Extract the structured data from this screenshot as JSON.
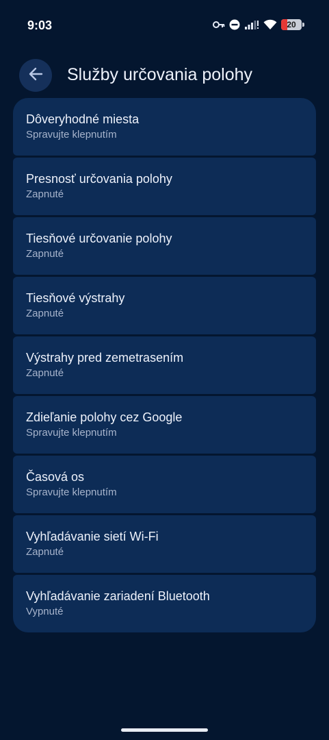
{
  "status": {
    "time": "9:03",
    "battery": "20",
    "icons": [
      "key-icon",
      "do-not-disturb-icon",
      "signal-icon",
      "wifi-icon",
      "battery-icon"
    ]
  },
  "header": {
    "title": "Služby určovania polohy",
    "back_icon": "arrow-left-icon"
  },
  "items": [
    {
      "title": "Dôveryhodné miesta",
      "subtitle": "Spravujte klepnutím"
    },
    {
      "title": "Presnosť určovania polohy",
      "subtitle": "Zapnuté"
    },
    {
      "title": "Tiesňové určovanie polohy",
      "subtitle": "Zapnuté"
    },
    {
      "title": "Tiesňové výstrahy",
      "subtitle": "Zapnuté"
    },
    {
      "title": "Výstrahy pred zemetrasením",
      "subtitle": "Zapnuté"
    },
    {
      "title": "Zdieľanie polohy cez Google",
      "subtitle": "Spravujte klepnutím"
    },
    {
      "title": "Časová os",
      "subtitle": "Spravujte klepnutím"
    },
    {
      "title": "Vyhľadávanie sietí Wi-Fi",
      "subtitle": "Zapnuté"
    },
    {
      "title": "Vyhľadávanie zariadení Bluetooth",
      "subtitle": "Vypnuté"
    }
  ],
  "colors": {
    "background": "#04162f",
    "card": "#0d2c56",
    "back_button": "#15305a",
    "battery_low": "#e53935"
  }
}
